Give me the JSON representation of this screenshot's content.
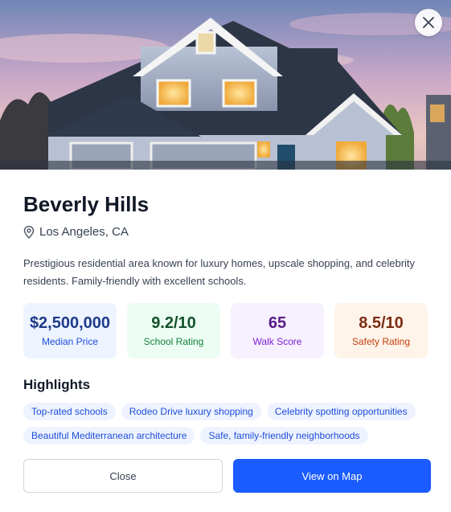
{
  "neighborhood": {
    "name": "Beverly Hills",
    "location": "Los Angeles, CA",
    "description": "Prestigious residential area known for luxury homes, upscale shopping, and celebrity residents. Family-friendly with excellent schools."
  },
  "stats": {
    "median_price": {
      "value": "$2,500,000",
      "label": "Median Price"
    },
    "school_rating": {
      "value": "9.2/10",
      "label": "School Rating"
    },
    "walk_score": {
      "value": "65",
      "label": "Walk Score"
    },
    "safety_rating": {
      "value": "8.5/10",
      "label": "Safety Rating"
    }
  },
  "highlights": {
    "title": "Highlights",
    "items": [
      "Top-rated schools",
      "Rodeo Drive luxury shopping",
      "Celebrity spotting opportunities",
      "Beautiful Mediterranean architecture",
      "Safe, family-friendly neighborhoods"
    ]
  },
  "actions": {
    "close_label": "Close",
    "map_label": "View on Map"
  },
  "icons": {
    "close": "close-icon",
    "location": "map-pin-icon"
  },
  "colors": {
    "primary": "#1a5cff",
    "price_bg": "#eef4ff",
    "school_bg": "#ecfdf3",
    "walk_bg": "#f7f0ff",
    "safety_bg": "#fff4ea"
  }
}
